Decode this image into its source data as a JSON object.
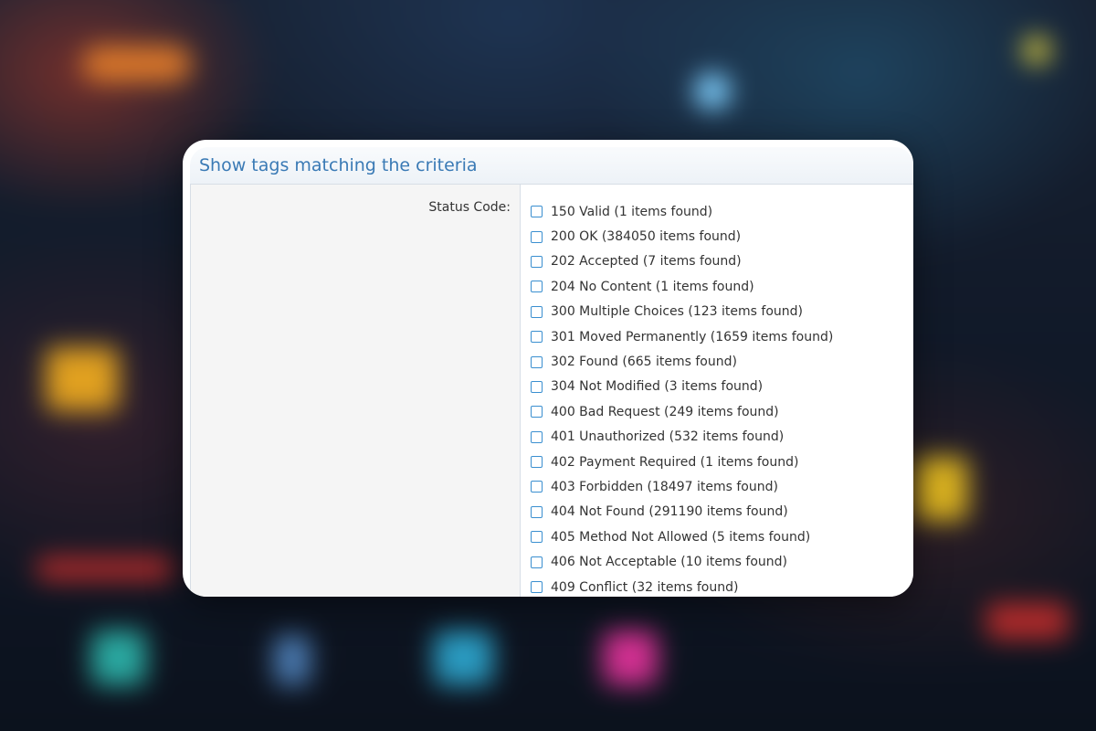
{
  "panel": {
    "title": "Show tags matching the criteria"
  },
  "filter": {
    "label": "Status Code:",
    "options": [
      {
        "label": "150 Valid (1 items found)",
        "checked": false
      },
      {
        "label": "200 OK (384050 items found)",
        "checked": false
      },
      {
        "label": "202 Accepted (7 items found)",
        "checked": false
      },
      {
        "label": "204 No Content (1 items found)",
        "checked": false
      },
      {
        "label": "300 Multiple Choices (123 items found)",
        "checked": false
      },
      {
        "label": "301 Moved Permanently (1659 items found)",
        "checked": false
      },
      {
        "label": "302 Found (665 items found)",
        "checked": false
      },
      {
        "label": "304 Not Modified (3 items found)",
        "checked": false
      },
      {
        "label": "400 Bad Request (249 items found)",
        "checked": false
      },
      {
        "label": "401 Unauthorized (532 items found)",
        "checked": false
      },
      {
        "label": "402 Payment Required (1 items found)",
        "checked": false
      },
      {
        "label": "403 Forbidden (18497 items found)",
        "checked": false
      },
      {
        "label": "404 Not Found (291190 items found)",
        "checked": false
      },
      {
        "label": "405 Method Not Allowed (5 items found)",
        "checked": false
      },
      {
        "label": "406 Not Acceptable (10 items found)",
        "checked": false
      },
      {
        "label": "409 Conflict (32 items found)",
        "checked": false
      }
    ]
  },
  "colors": {
    "title": "#3a7ab5",
    "checkbox_border": "#3a8fd0",
    "label_column_bg": "#f5f5f5"
  }
}
